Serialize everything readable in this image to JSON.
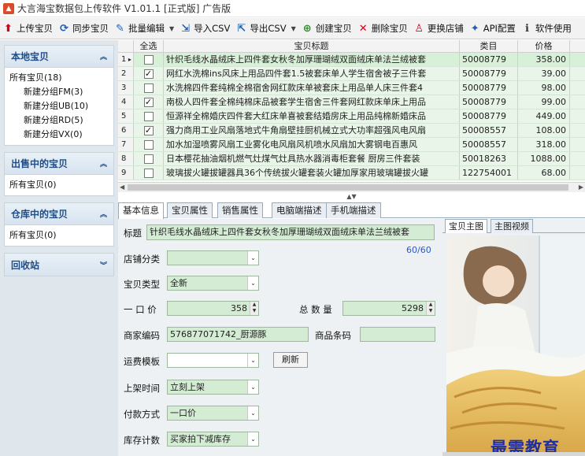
{
  "window": {
    "title": "大言海宝数据包上传软件 V1.01.1 [正式版] 广告版"
  },
  "toolbar": [
    {
      "label": "上传宝贝",
      "icon": "upload-arrow-icon",
      "color": "#d0021b"
    },
    {
      "label": "同步宝贝",
      "icon": "sync-icon",
      "color": "#1a5fb4"
    },
    {
      "label": "批量编辑",
      "icon": "pencil-icon",
      "color": "#1a5fb4",
      "dropdown": true
    },
    {
      "label": "导入CSV",
      "icon": "import-icon",
      "color": "#1a5fb4"
    },
    {
      "label": "导出CSV",
      "icon": "export-icon",
      "color": "#1a5fb4",
      "dropdown": true
    },
    {
      "label": "创建宝贝",
      "icon": "add-circle-icon",
      "color": "#2e8b2e"
    },
    {
      "label": "删除宝贝",
      "icon": "delete-x-icon",
      "color": "#d0021b"
    },
    {
      "label": "更换店铺",
      "icon": "user-icon",
      "color": "#d0021b"
    },
    {
      "label": "API配置",
      "icon": "magic-wand-icon",
      "color": "#1a5fb4"
    },
    {
      "label": "软件使用",
      "icon": "info-icon",
      "color": "#333"
    }
  ],
  "sidebar": {
    "groups": [
      {
        "title": "本地宝贝",
        "items": [
          {
            "label": "所有宝贝(18)",
            "sub": false
          },
          {
            "label": "新建分组FM(3)",
            "sub": true
          },
          {
            "label": "新建分组UB(10)",
            "sub": true
          },
          {
            "label": "新建分组RD(5)",
            "sub": true
          },
          {
            "label": "新建分组VX(0)",
            "sub": true
          }
        ]
      },
      {
        "title": "出售中的宝贝",
        "items": [
          {
            "label": "所有宝贝(0)",
            "sub": false
          }
        ]
      },
      {
        "title": "仓库中的宝贝",
        "items": [
          {
            "label": "所有宝贝(0)",
            "sub": false
          }
        ]
      },
      {
        "title": "回收站",
        "items": []
      }
    ]
  },
  "grid": {
    "headers": {
      "select_all": "全选",
      "title": "宝贝标题",
      "category": "类目",
      "price": "价格"
    },
    "rows": [
      {
        "num": "1",
        "checked": false,
        "title": "针织毛线水晶绒床上四件套女秋冬加厚珊瑚绒双面绒床单法兰绒被套",
        "category": "50008779",
        "price": "358.00",
        "current": true
      },
      {
        "num": "2",
        "checked": true,
        "title": "网红水洗棉ins风床上用品四件套1.5被套床单人学生宿舍被子三件套",
        "category": "50008779",
        "price": "39.00"
      },
      {
        "num": "3",
        "checked": false,
        "title": "水洗棉四件套纯棉全棉宿舍网红款床单被套床上用品单人床三件套4",
        "category": "50008779",
        "price": "98.00"
      },
      {
        "num": "4",
        "checked": true,
        "title": "南极人四件套全棉纯棉床品被套学生宿舍三件套网红款床单床上用品",
        "category": "50008779",
        "price": "99.00"
      },
      {
        "num": "5",
        "checked": false,
        "title": "恒源祥全棉婚庆四件套大红床单喜被套结婚房床上用品纯棉新婚床品",
        "category": "50008779",
        "price": "449.00"
      },
      {
        "num": "6",
        "checked": true,
        "title": "强力商用工业风扇落地式牛角扇壁挂厨机械立式大功率超强风电风扇",
        "category": "50008557",
        "price": "108.00"
      },
      {
        "num": "7",
        "checked": false,
        "title": "加水加湿喷雾风扇工业雾化电风扇风机喷水风扇加大雾钢电百惠风",
        "category": "50008557",
        "price": "318.00"
      },
      {
        "num": "8",
        "checked": false,
        "title": "日本樱花抽油烟机燃气灶煤气灶具热水器消毒柜套餐 厨房三件套装",
        "category": "50018263",
        "price": "1088.00"
      },
      {
        "num": "9",
        "checked": false,
        "title": "玻璃拔火罐拔罐器具36个传统拔火罐套装火罐加厚家用玻璃罐拔火罐",
        "category": "122754001",
        "price": "68.00"
      }
    ]
  },
  "detail_tabs": [
    "基本信息",
    "宝贝属性",
    "销售属性",
    "电脑端描述",
    "手机端描述"
  ],
  "form": {
    "title_label": "标题",
    "title_value": "针织毛线水晶绒床上四件套女秋冬加厚珊瑚绒双面绒床单法兰绒被套",
    "title_counter": "60/60",
    "shop_category_label": "店铺分类",
    "shop_category_value": "",
    "item_type_label": "宝贝类型",
    "item_type_value": "全新",
    "price_label": "一 口 价",
    "price_value": "358",
    "quantity_label": "总 数 量",
    "quantity_value": "5298",
    "merchant_code_label": "商家编码",
    "merchant_code_value": "576877071742_厨源豚",
    "barcode_label": "商品条码",
    "barcode_value": "",
    "shipping_template_label": "运费模板",
    "shipping_template_value": "",
    "refresh_label": "刷新",
    "listing_time_label": "上架时间",
    "listing_time_value": "立刻上架",
    "payment_label": "付款方式",
    "payment_value": "一口价",
    "stock_label": "库存计数",
    "stock_value": "买家拍下减库存"
  },
  "right_tabs": [
    "宝贝主图",
    "主图视频"
  ],
  "watermark": "最需教育"
}
